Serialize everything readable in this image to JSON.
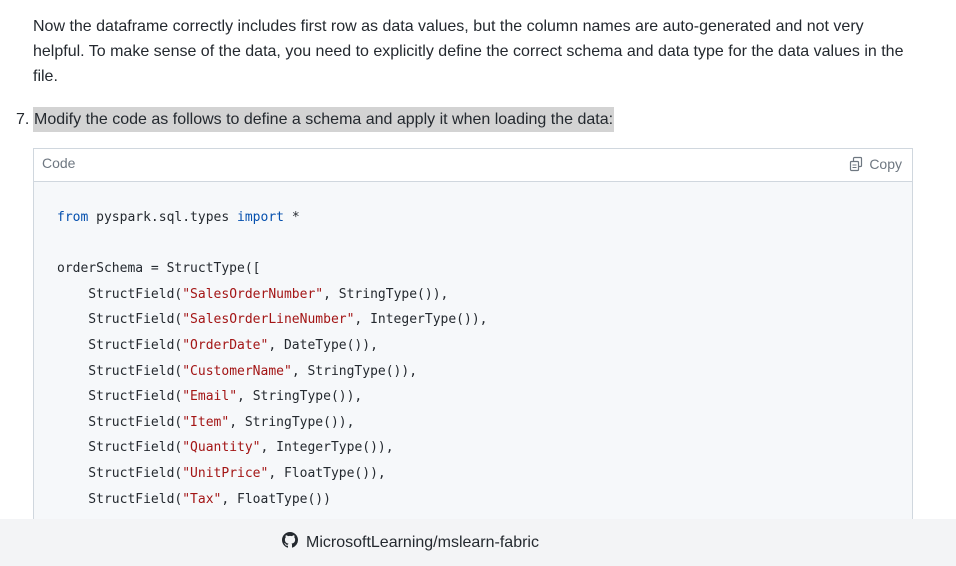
{
  "intro": {
    "text": "Now the dataframe correctly includes first row as data values, but the column names are auto-generated and not very helpful. To make sense of the data, you need to explicitly define the correct schema and data type for the data values in the file."
  },
  "step": {
    "number": "7.",
    "text": "Modify the code as follows to define a schema and apply it when loading the data:"
  },
  "code_block": {
    "language_label": "Code",
    "copy_label": "Copy",
    "lines": {
      "l1_from": "from",
      "l1_module": " pyspark.sql.types ",
      "l1_import": "import",
      "l1_star": " *",
      "l2": "orderSchema = StructType([",
      "fields": [
        {
          "name": "\"SalesOrderNumber\"",
          "type": "StringType()),"
        },
        {
          "name": "\"SalesOrderLineNumber\"",
          "type": "IntegerType()),"
        },
        {
          "name": "\"OrderDate\"",
          "type": "DateType()),"
        },
        {
          "name": "\"CustomerName\"",
          "type": "StringType()),"
        },
        {
          "name": "\"Email\"",
          "type": "StringType()),"
        },
        {
          "name": "\"Item\"",
          "type": "StringType()),"
        },
        {
          "name": "\"Quantity\"",
          "type": "IntegerType()),"
        },
        {
          "name": "\"UnitPrice\"",
          "type": "FloatType()),"
        },
        {
          "name": "\"Tax\"",
          "type": "FloatType())"
        }
      ],
      "field_prefix": "    StructField(",
      "field_sep": ", "
    }
  },
  "footer": {
    "repo_label": "MicrosoftLearning/mslearn-fabric",
    "icon": "github-icon"
  }
}
